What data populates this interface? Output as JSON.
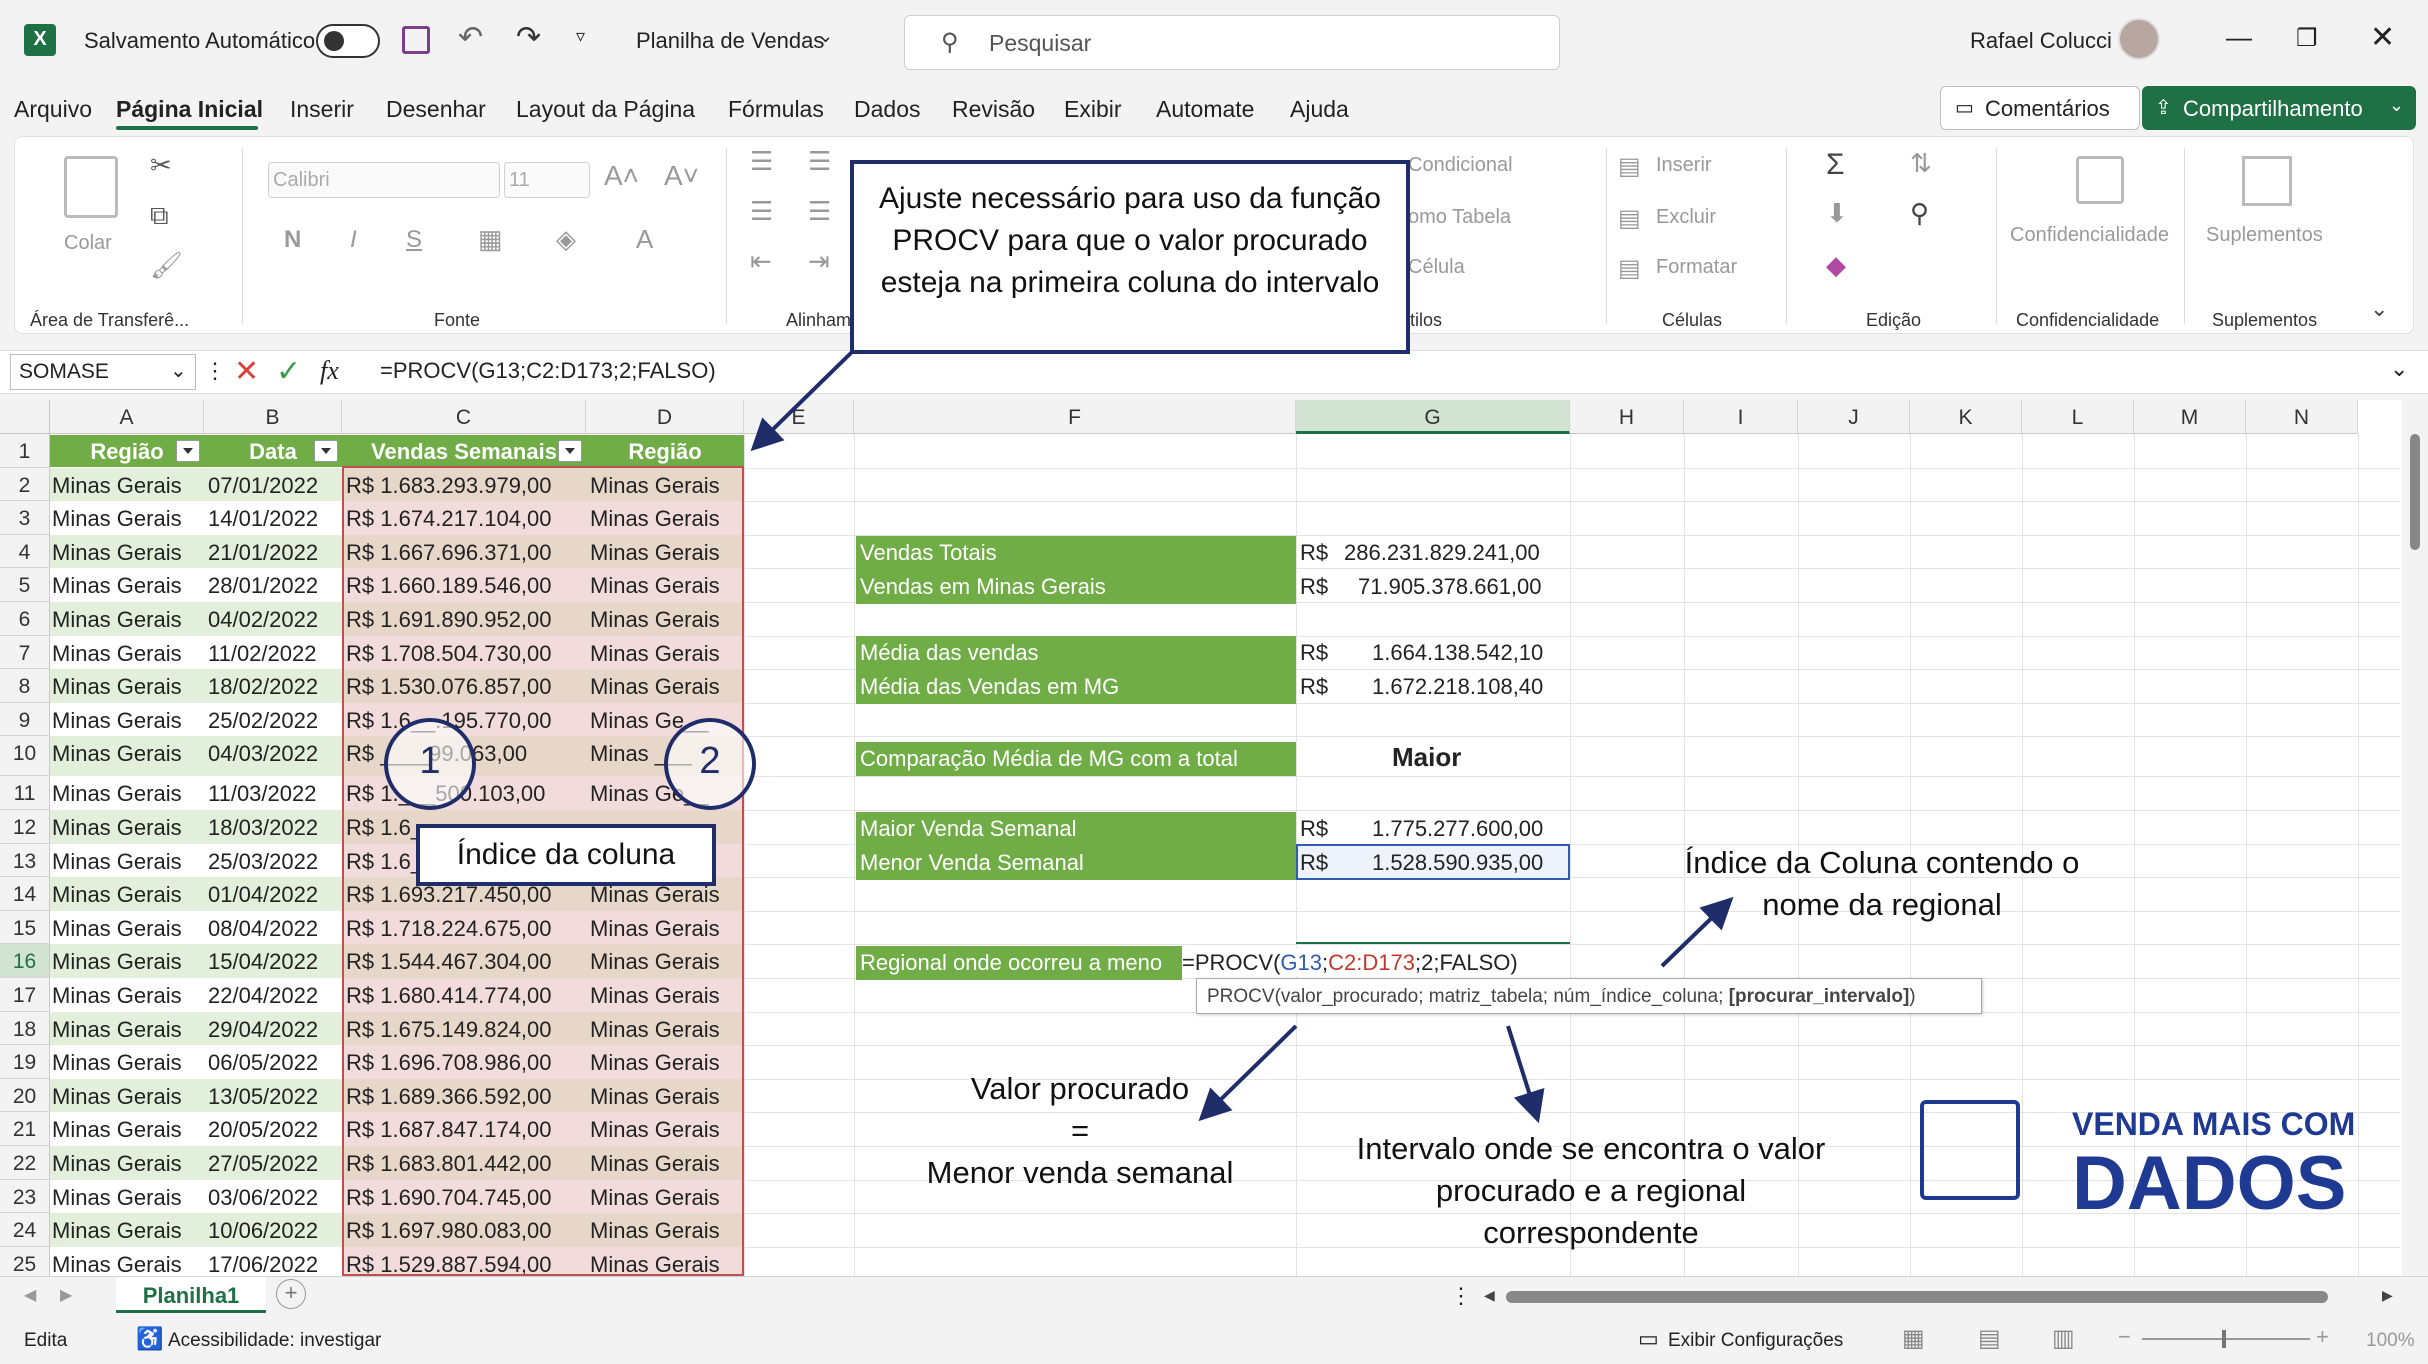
{
  "titlebar": {
    "autosave_label": "Salvamento Automático",
    "doc_title": "Planilha de Vendas",
    "search_placeholder": "Pesquisar",
    "user": "Rafael Colucci"
  },
  "menu": [
    "Arquivo",
    "Página Inicial",
    "Inserir",
    "Desenhar",
    "Layout da Página",
    "Fórmulas",
    "Dados",
    "Revisão",
    "Exibir",
    "Automate",
    "Ajuda"
  ],
  "actions": {
    "comments": "Comentários",
    "share": "Compartilhamento"
  },
  "ribbon": {
    "paste": "Colar",
    "font_name": "Calibri",
    "font_size": "11",
    "bold": "N",
    "italic": "I",
    "underline": "S",
    "cond_format": "Condicional",
    "as_table": "omo Tabela",
    "cell_styles": "Célula",
    "insert": "Inserir",
    "delete": "Excluir",
    "format": "Formatar",
    "sensitivity": "Confidencialidade",
    "addins": "Suplementos",
    "groups": [
      "Área de Transferê...",
      "Fonte",
      "Alinham",
      "tilos",
      "Células",
      "Edição",
      "Confidencialidade",
      "Suplementos"
    ]
  },
  "formula_bar": {
    "name_box": "SOMASE",
    "fx": "fx",
    "formula": "=PROCV(G13;C2:D173;2;FALSO)"
  },
  "columns": [
    "A",
    "B",
    "C",
    "D",
    "E",
    "F",
    "G",
    "H",
    "I",
    "J",
    "K",
    "L",
    "M",
    "N"
  ],
  "table": {
    "headers": [
      "Região",
      "Data",
      "Vendas Semanais",
      "Região"
    ],
    "rows": [
      [
        "Minas Gerais",
        "07/01/2022",
        "R$ 1.683.293.979,00",
        "Minas Gerais"
      ],
      [
        "Minas Gerais",
        "14/01/2022",
        "R$ 1.674.217.104,00",
        "Minas Gerais"
      ],
      [
        "Minas Gerais",
        "21/01/2022",
        "R$ 1.667.696.371,00",
        "Minas Gerais"
      ],
      [
        "Minas Gerais",
        "28/01/2022",
        "R$ 1.660.189.546,00",
        "Minas Gerais"
      ],
      [
        "Minas Gerais",
        "04/02/2022",
        "R$ 1.691.890.952,00",
        "Minas Gerais"
      ],
      [
        "Minas Gerais",
        "11/02/2022",
        "R$ 1.708.504.730,00",
        "Minas Gerais"
      ],
      [
        "Minas Gerais",
        "18/02/2022",
        "R$ 1.530.076.857,00",
        "Minas Gerais"
      ],
      [
        "Minas Gerais",
        "25/02/2022",
        "R$ 1.6__.195.770,00",
        "Minas Ge__"
      ],
      [
        "Minas Gerais",
        "04/03/2022",
        "R$ ____99.063,00",
        "Minas ___"
      ],
      [
        "Minas Gerais",
        "11/03/2022",
        "R$ 1.___500.103,00",
        "Minas Ge__"
      ],
      [
        "Minas Gerais",
        "18/03/2022",
        "R$ 1.6__________",
        "________"
      ],
      [
        "Minas Gerais",
        "25/03/2022",
        "R$ 1.6__________",
        "________"
      ],
      [
        "Minas Gerais",
        "01/04/2022",
        "R$ 1.693.217.450,00",
        "Minas Gerais"
      ],
      [
        "Minas Gerais",
        "08/04/2022",
        "R$ 1.718.224.675,00",
        "Minas Gerais"
      ],
      [
        "Minas Gerais",
        "15/04/2022",
        "R$ 1.544.467.304,00",
        "Minas Gerais"
      ],
      [
        "Minas Gerais",
        "22/04/2022",
        "R$ 1.680.414.774,00",
        "Minas Gerais"
      ],
      [
        "Minas Gerais",
        "29/04/2022",
        "R$ 1.675.149.824,00",
        "Minas Gerais"
      ],
      [
        "Minas Gerais",
        "06/05/2022",
        "R$ 1.696.708.986,00",
        "Minas Gerais"
      ],
      [
        "Minas Gerais",
        "13/05/2022",
        "R$ 1.689.366.592,00",
        "Minas Gerais"
      ],
      [
        "Minas Gerais",
        "20/05/2022",
        "R$ 1.687.847.174,00",
        "Minas Gerais"
      ],
      [
        "Minas Gerais",
        "27/05/2022",
        "R$ 1.683.801.442,00",
        "Minas Gerais"
      ],
      [
        "Minas Gerais",
        "03/06/2022",
        "R$ 1.690.704.745,00",
        "Minas Gerais"
      ],
      [
        "Minas Gerais",
        "10/06/2022",
        "R$ 1.697.980.083,00",
        "Minas Gerais"
      ],
      [
        "Minas Gerais",
        "17/06/2022",
        "R$ 1.529.887.594,00",
        "Minas Gerais"
      ]
    ]
  },
  "summary": {
    "vendas_totais": "Vendas Totais",
    "vendas_totais_val": "286.231.829.241,00",
    "vendas_mg": "Vendas em Minas Gerais",
    "vendas_mg_val": "71.905.378.661,00",
    "media": "Média das vendas",
    "media_val": "1.664.138.542,10",
    "media_mg": "Média das Vendas em MG",
    "media_mg_val": "1.672.218.108,40",
    "comparacao": "Comparação Média de MG com a total",
    "comparacao_val": "Maior",
    "maior": "Maior Venda Semanal",
    "maior_val": "1.775.277.600,00",
    "menor": "Menor Venda Semanal",
    "menor_val": "1.528.590.935,00",
    "regional": "Regional onde ocorreu a meno",
    "currency": "R$",
    "edit_formula": {
      "prefix": "=PROCV(",
      "ref1": "G13",
      "sep1": ";",
      "ref2": "C2:D173",
      "rest": ";2;FALSO)"
    },
    "tooltip": {
      "text": "PROCV(valor_procurado; matriz_tabela; núm_índice_coluna; ",
      "bold": "[procurar_intervalo]",
      "end": ")"
    }
  },
  "annotations": {
    "callout_top": "Ajuste necessário para uso da função PROCV para que o valor procurado esteja na primeira coluna do intervalo",
    "circle1": "1",
    "circle2": "2",
    "indice_coluna": "Índice da coluna",
    "indice_regional": "Índice da Coluna contendo o nome da regional",
    "valor_procurado_1": "Valor procurado",
    "valor_procurado_eq": "=",
    "valor_procurado_2": "Menor venda semanal",
    "intervalo": "Intervalo onde se encontra o valor procurado e a regional correspondente",
    "logo_line1": "VENDA MAIS COM",
    "logo_line2": "DADOS"
  },
  "sheet_tab": "Planilha1",
  "status": {
    "mode": "Edita",
    "accessibility": "Acessibilidade: investigar",
    "display_settings": "Exibir Configurações",
    "zoom": "100%"
  },
  "colors": {
    "excel_green": "#1e7145",
    "table_green": "#70ad47",
    "callout_navy": "#1f2d6b",
    "highlight_rose": "#f2dcdb",
    "ref_blue": "#2f5db5",
    "ref_red": "#c0392b"
  }
}
